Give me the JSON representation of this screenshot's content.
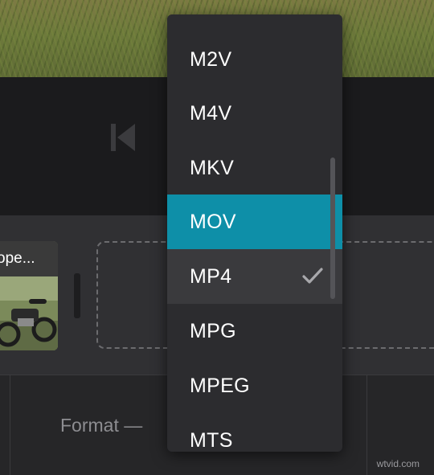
{
  "clip": {
    "title": "ope..."
  },
  "format": {
    "label": "Format —"
  },
  "dropdown": {
    "options": [
      {
        "label": "M2V",
        "state": "normal"
      },
      {
        "label": "M4V",
        "state": "normal"
      },
      {
        "label": "MKV",
        "state": "normal"
      },
      {
        "label": "MOV",
        "state": "highlighted"
      },
      {
        "label": "MP4",
        "state": "selected"
      },
      {
        "label": "MPG",
        "state": "normal"
      },
      {
        "label": "MPEG",
        "state": "normal"
      },
      {
        "label": "MTS",
        "state": "normal"
      }
    ],
    "selected_value": "MP4",
    "highlight_color": "#0e8fa8"
  },
  "watermark": "wtvid.com"
}
